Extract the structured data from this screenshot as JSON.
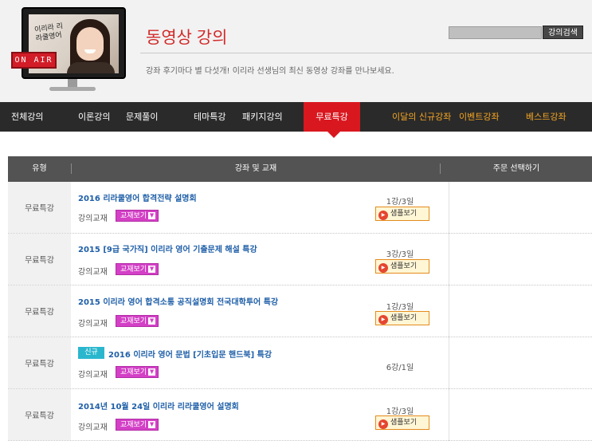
{
  "header": {
    "title": "동영상 강의",
    "subtitle": "강좌 후기마다 별 다섯개! 이리라 선생님의 최신 동영상 강좌를 만나보세요.",
    "monitor_handwriting": "이리라 리라쿨영어",
    "onair_label": "ON AIR",
    "search_button": "강의검색"
  },
  "nav": {
    "items": [
      {
        "label": "전체강의"
      },
      {
        "label": "이론강의"
      },
      {
        "label": "문제풀이"
      },
      {
        "label": "테마특강"
      },
      {
        "label": "패키지강의"
      },
      {
        "label": "무료특강"
      }
    ],
    "highlight_items": [
      {
        "label": "이달의 신규강좌"
      },
      {
        "label": "이벤트강좌"
      },
      {
        "label": "베스트강좌"
      }
    ]
  },
  "table": {
    "headers": {
      "type": "유형",
      "course": "강좌 및 교재",
      "order": "주문 선택하기"
    },
    "book_label": "강의교재",
    "book_button": "교재보기",
    "sample_button": "샘플보기",
    "rows": [
      {
        "type": "무료특강",
        "title": "2016 리라쿨영어 합격전략 설명회",
        "period": "1강/3일",
        "has_sample": true
      },
      {
        "type": "무료특강",
        "title": "2015 [9급 국가직] 이리라 영어 기출문제 해설 특강",
        "period": "3강/3일",
        "has_sample": true
      },
      {
        "type": "무료특강",
        "title": "2015 이리라 영어 합격소통 공직설명회 전국대학투어 특강",
        "period": "1강/3일",
        "has_sample": true
      },
      {
        "type": "무료특강",
        "badge": "신규",
        "title": "2016 이리라 영어 문법 [기초입문 핸드북] 특강",
        "period": "6강/1일",
        "has_sample": false
      },
      {
        "type": "무료특강",
        "title": "2014년 10월 24일 이리라 리라쿨영어 설명회",
        "period": "1강/3일",
        "has_sample": true
      }
    ]
  },
  "colors": {
    "accent_red": "#d9171f",
    "nav_bg": "#2a2a2a",
    "link_blue": "#1f5fa8",
    "book_pink": "#d340c6",
    "new_badge": "#2ab7ce",
    "nav_highlight": "#f5a623"
  }
}
